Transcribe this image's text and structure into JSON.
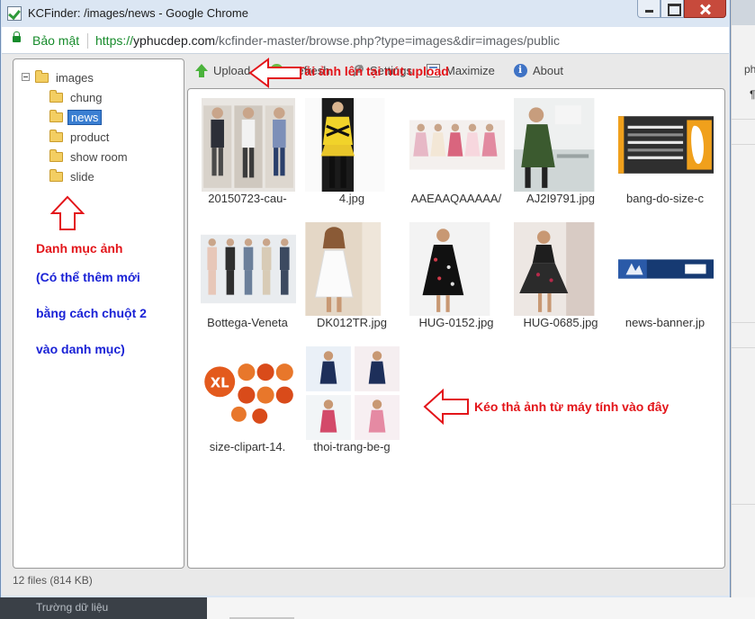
{
  "window": {
    "title": "KCFinder: /images/news - Google Chrome"
  },
  "addressbar": {
    "secure_label": "Bảo mật",
    "url_scheme": "https://",
    "url_host": "yphucdep.com",
    "url_path": "/kcfinder-master/browse.php?type=images&dir=images/public"
  },
  "tree": {
    "root": "images",
    "folders": [
      "chung",
      "news",
      "product",
      "show room",
      "slide"
    ],
    "selected": "news"
  },
  "toolbar": {
    "upload": "Upload",
    "refresh": "Refresh",
    "settings": "Settings",
    "maximize": "Maximize",
    "about": "About"
  },
  "files": [
    {
      "name": "20150723-cau-",
      "thumb": "kids-suits"
    },
    {
      "name": "4.jpg",
      "thumb": "runway-dress"
    },
    {
      "name": "AAEAAQAAAAA/",
      "thumb": "dress-lineup"
    },
    {
      "name": "AJ2I9791.jpg",
      "thumb": "green-coat"
    },
    {
      "name": "bang-do-size-c",
      "thumb": "size-chart"
    },
    {
      "name": "Bottega-Veneta",
      "thumb": "menswear-lineup"
    },
    {
      "name": "DK012TR.jpg",
      "thumb": "white-dress"
    },
    {
      "name": "HUG-0152.jpg",
      "thumb": "black-dress"
    },
    {
      "name": "HUG-0685.jpg",
      "thumb": "party-dress"
    },
    {
      "name": "news-banner.jp",
      "thumb": "news-banner"
    },
    {
      "name": "size-clipart-14.",
      "thumb": "size-clipart"
    },
    {
      "name": "thoi-trang-be-g",
      "thumb": "kids-collage"
    }
  ],
  "status": "12 files (814 KB)",
  "annotations": {
    "upload_note": "Tải ảnh lên tại nút upload",
    "folders_title": "Danh mục ảnh",
    "folders_note_1": "(Có thể thêm mới",
    "folders_note_2": "bằng cách chuột 2",
    "folders_note_3": "vào danh mục)",
    "drop_note": "Kéo thả ảnh từ máy tính vào đây"
  },
  "background": {
    "right_text": "ph",
    "right_mark": "¶",
    "bottom_text": "Trường dữ liệu"
  }
}
